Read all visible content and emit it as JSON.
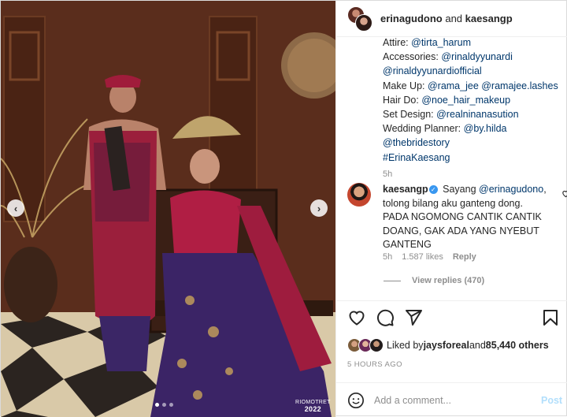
{
  "post": {
    "photo": {
      "watermark_brand": "RIOMOTRET",
      "watermark_year": "2022",
      "slide_dots": 3,
      "active_dot": 1
    }
  },
  "header": {
    "user1": "erinagudono",
    "joiner": "and",
    "user2": "kaesangp"
  },
  "caption": {
    "lines": [
      {
        "label": "Attire: ",
        "handle": "@tirta_harum"
      },
      {
        "label": "Accessories: ",
        "handle": "@rinaldyyunardi"
      },
      {
        "label": "",
        "handle": "@rinaldyyunardiofficial"
      },
      {
        "label": "Make Up: ",
        "handle": "@rama_jee @ramajee.lashes"
      },
      {
        "label": "Hair Do: ",
        "handle": "@noe_hair_makeup"
      },
      {
        "label": "Set Design: ",
        "handle": "@realninanasution"
      },
      {
        "label": "Wedding Planner: ",
        "handle": "@by.hilda"
      },
      {
        "label": "",
        "handle": "@thebridestory"
      },
      {
        "label": "",
        "handle": "#ErinaKaesang"
      }
    ],
    "time": "5h"
  },
  "comment": {
    "user": "kaesangp",
    "verified_mark": "✓",
    "text_start": " Sayang ",
    "mention": "@erinagudono",
    "text_rest": ", tolong bilang aku ganteng dong. PADA NGOMONG CANTIK CANTIK DOANG, GAK ADA YANG NYEBUT GANTENG",
    "time": "5h",
    "likes": "1.587 likes",
    "reply_label": "Reply",
    "view_replies": "View replies (470)"
  },
  "likes": {
    "prefix": "Liked by ",
    "user": "jaysforeal",
    "middle": " and ",
    "others": "85,440 others"
  },
  "posted_time": "5 HOURS AGO",
  "add_comment": {
    "placeholder": "Add a comment...",
    "post_label": "Post"
  },
  "colors": {
    "link": "#00376b",
    "meta": "#8e8e8e",
    "verified": "#3897f0",
    "post_disabled": "#b2dffc"
  }
}
